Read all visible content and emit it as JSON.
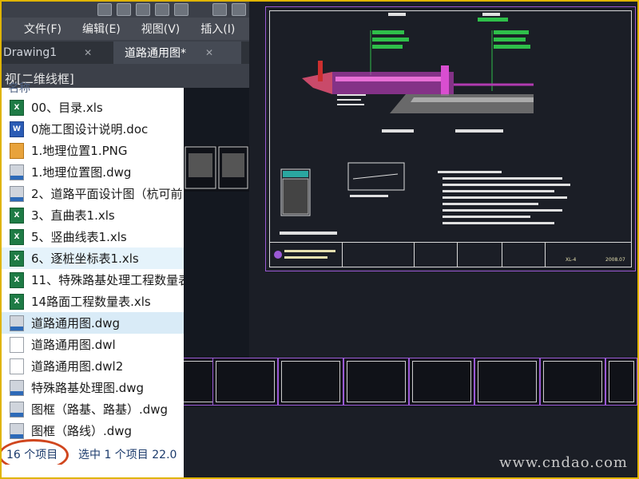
{
  "app": {
    "menu": [
      "文件(F)",
      "编辑(E)",
      "视图(V)",
      "插入(I)"
    ],
    "tabs": [
      {
        "label": "Drawing1",
        "close": "✕"
      },
      {
        "label": "道路通用图*",
        "close": "✕"
      }
    ],
    "viewport_label": "视[二维线框]"
  },
  "file_list": {
    "column_header": "名称",
    "items": [
      {
        "name": "00、目录.xls",
        "type": "xls"
      },
      {
        "name": "0施工图设计说明.doc",
        "type": "doc"
      },
      {
        "name": "1.地理位置1.PNG",
        "type": "png"
      },
      {
        "name": "1.地理位置图.dwg",
        "type": "dwg"
      },
      {
        "name": "2、道路平面设计图（杭可前",
        "type": "dwg"
      },
      {
        "name": "3、直曲表1.xls",
        "type": "xls"
      },
      {
        "name": "5、竖曲线表1.xls",
        "type": "xls"
      },
      {
        "name": "6、逐桩坐标表1.xls",
        "type": "xls",
        "state": "hover"
      },
      {
        "name": "11、特殊路基处理工程数量表",
        "type": "xls"
      },
      {
        "name": "14路面工程数量表.xls",
        "type": "xls"
      },
      {
        "name": "道路通用图.dwg",
        "type": "dwg",
        "state": "selected"
      },
      {
        "name": "道路通用图.dwl",
        "type": "dwl"
      },
      {
        "name": "道路通用图.dwl2",
        "type": "dwl"
      },
      {
        "name": "特殊路基处理图.dwg",
        "type": "dwg"
      },
      {
        "name": "图框（路基、路基）.dwg",
        "type": "dwg"
      },
      {
        "name": "图框（路线）.dwg",
        "type": "dwg"
      }
    ]
  },
  "status": {
    "count": "16 个项目",
    "selected": "选中 1 个项目  22.0"
  },
  "drawing": {
    "titleblock": {
      "date": "2008.07",
      "sheet_no": "XL-4"
    }
  },
  "watermark": "www.cndao.com",
  "colors": {
    "highlight": "#d0461e",
    "selected_row": "#d9ebf7",
    "frame": "#e0b400",
    "sheet_border": "#9b59d6"
  }
}
